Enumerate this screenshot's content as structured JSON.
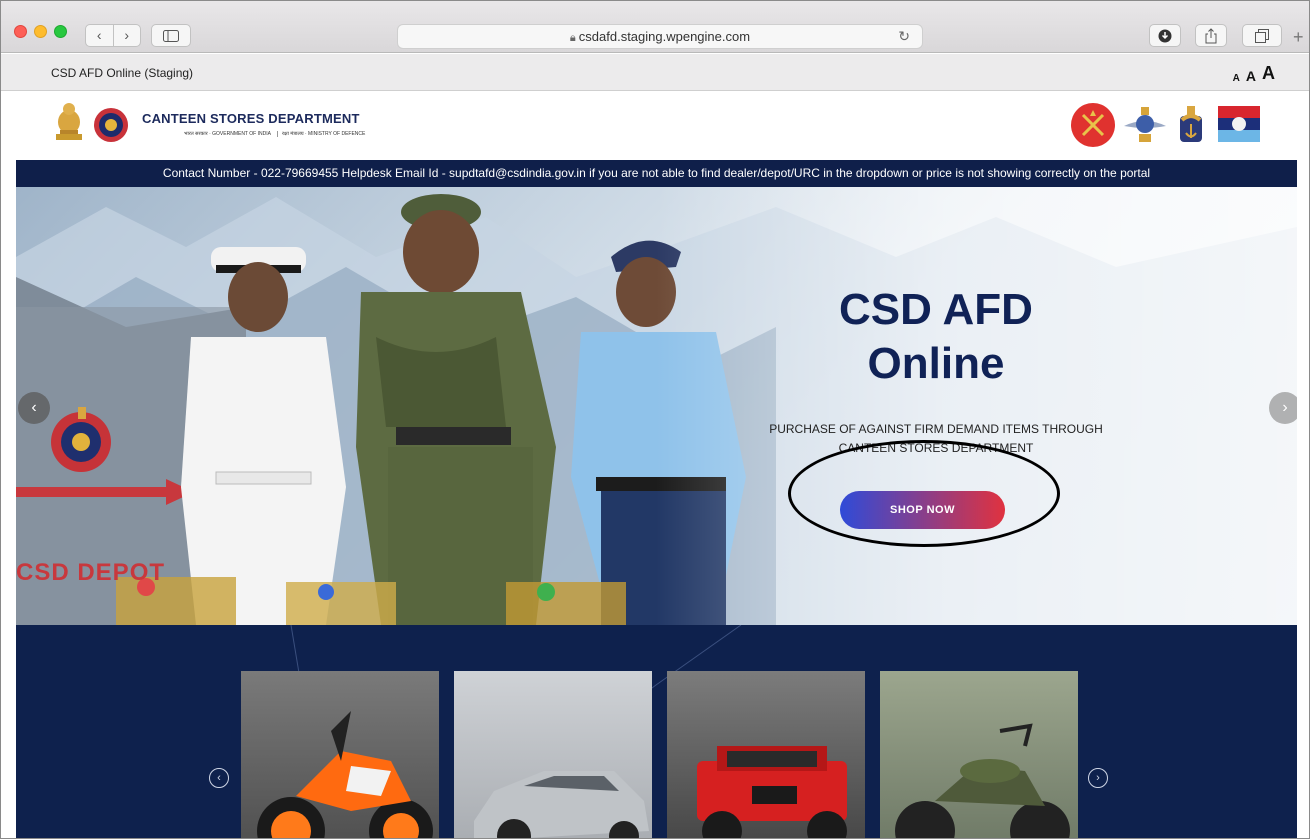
{
  "browser": {
    "url": "csdafd.staging.wpengine.com",
    "tab_title": "CSD AFD Online (Staging)",
    "font_controls": [
      "A",
      "A",
      "A"
    ]
  },
  "header": {
    "brand_title": "CANTEEN STORES DEPARTMENT",
    "brand_sub_1": "भारत सरकार · GOVERNMENT OF INDIA",
    "brand_sub_2": "रक्षा मंत्रालय · MINISTRY OF DEFENCE",
    "insignia": [
      "army-insignia",
      "air-force-insignia",
      "navy-insignia",
      "tri-service-flag"
    ]
  },
  "notice": {
    "text": "Contact Number - 022-79669455 Helpdesk Email Id - supdtafd@csdindia.gov.in if you are not able to find dealer/depot/URC in the dropdown or price is not showing correctly on the portal"
  },
  "hero": {
    "title_line1": "CSD AFD",
    "title_line2": "Online",
    "subtitle_line1": "PURCHASE OF AGAINST FIRM DEMAND ITEMS THROUGH",
    "subtitle_line2": "CANTEEN STORES DEPARTMENT",
    "cta_label": "SHOP NOW",
    "depot_sign": "CSD DEPOT"
  },
  "products": {
    "cards": [
      "orange-motorcycle",
      "silver-hatchback-car",
      "red-suv",
      "green-classic-motorcycle"
    ]
  },
  "colors": {
    "navy": "#0f1f4a",
    "cta_start": "#2f4bd8",
    "cta_end": "#e0323f"
  }
}
